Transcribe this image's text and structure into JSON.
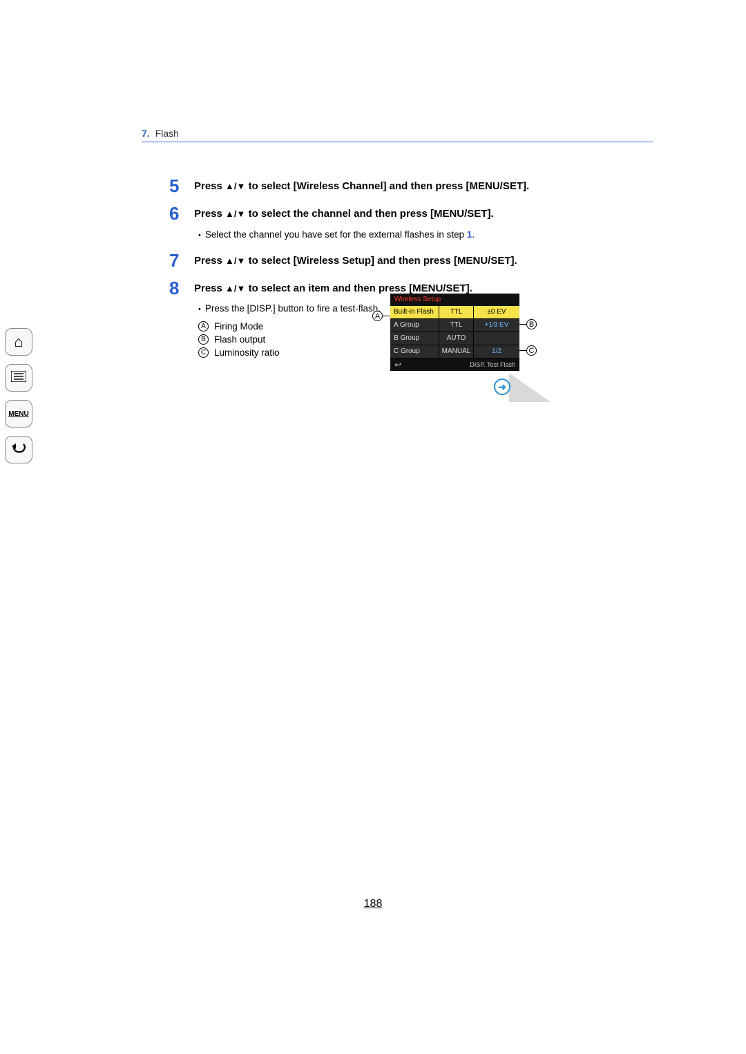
{
  "header": {
    "number": "7.",
    "title": "Flash"
  },
  "sidebar": {
    "home": "⌂",
    "toc": "≣",
    "menu": "MENU",
    "back": "↶"
  },
  "steps": [
    {
      "num": "5",
      "title_parts": [
        "Press ",
        "▲/▼",
        " to select [Wireless Channel] and then press [MENU/SET]."
      ]
    },
    {
      "num": "6",
      "title_parts": [
        "Press ",
        "▲/▼",
        " to select the channel and then press [MENU/SET]."
      ],
      "bullet": {
        "pre": "Select the channel you have set for the external flashes in step ",
        "link": "1",
        "post": "."
      }
    },
    {
      "num": "7",
      "title_parts": [
        "Press ",
        "▲/▼",
        " to select [Wireless Setup] and then press [MENU/SET]."
      ]
    },
    {
      "num": "8",
      "title_parts": [
        "Press ",
        "▲/▼",
        " to select an item and then press [MENU/SET]."
      ],
      "bullet": {
        "pre": "Press the [DISP.] button to fire a test-flash.",
        "link": "",
        "post": ""
      },
      "legend": [
        {
          "mark": "A",
          "text": "Firing Mode"
        },
        {
          "mark": "B",
          "text": "Flash output"
        },
        {
          "mark": "C",
          "text": "Luminosity ratio"
        }
      ]
    }
  ],
  "lcd": {
    "title": "Wireless Setup",
    "rows": [
      {
        "name": "Built-in Flash",
        "mode": "TTL",
        "val": "±0 EV",
        "selected": true
      },
      {
        "name": "A Group",
        "mode": "TTL",
        "val": "+1⁄3 EV",
        "selected": false
      },
      {
        "name": "B Group",
        "mode": "AUTO",
        "val": "",
        "selected": false
      },
      {
        "name": "C Group",
        "mode": "MANUAL",
        "val": "1/2",
        "selected": false
      }
    ],
    "footer_right": "DISP. Test Flash",
    "back": "↩"
  },
  "callouts": {
    "A": "A",
    "B": "B",
    "C": "C"
  },
  "corner_arrow": "➜",
  "page_number": "188"
}
